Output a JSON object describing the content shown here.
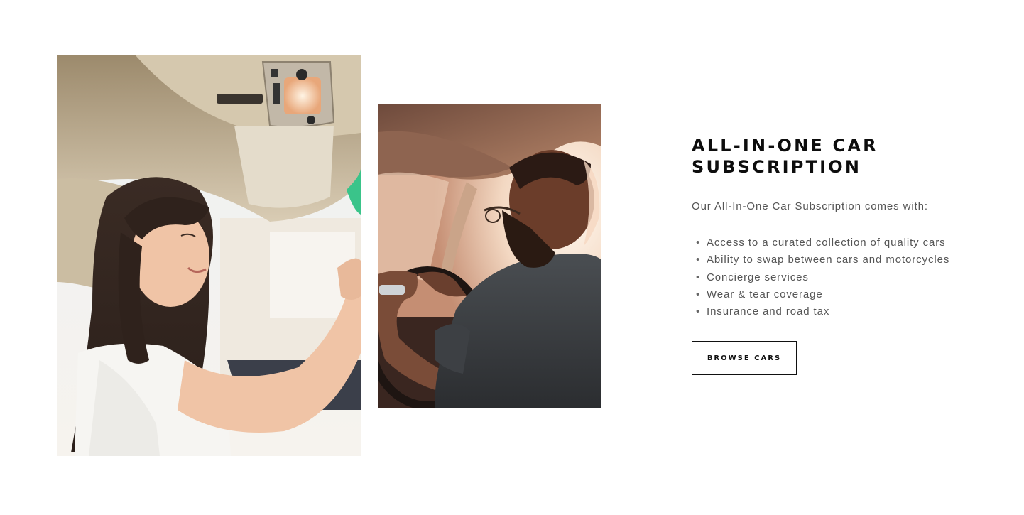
{
  "section": {
    "title": "ALL-IN-ONE CAR SUBSCRIPTION",
    "intro": "Our All-In-One Car Subscription comes with:",
    "features": [
      "Access to a curated collection of quality cars",
      "Ability to swap between cars and motorcycles",
      "Concierge services",
      "Wear & tear coverage",
      "Insurance and road tax"
    ],
    "bullet": "•",
    "button_label": "BROWSE CARS"
  },
  "images": {
    "left_photo_subject": "woman-driving-photo",
    "right_photo_subject": "man-driving-photo"
  },
  "colors": {
    "title": "#0d0d0d",
    "body_text": "#555555",
    "button_border": "#111111",
    "background": "#ffffff"
  }
}
